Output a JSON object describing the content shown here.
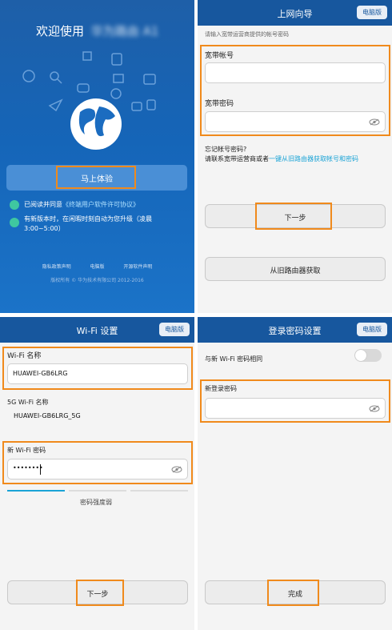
{
  "screen1": {
    "welcome": "欢迎使用",
    "blurred_brand": "华为路由 A1",
    "start_button": "马上体验",
    "agree_prefix": "已阅读并同意",
    "agree_link": "《终端用户软件许可协议》",
    "update_notice": "有新版本时，在闲暇时刻自动为您升级（凌晨3:00~5:00）",
    "footer_links": [
      "隐私政策声明",
      "电脑版",
      "开源软件声明"
    ],
    "copyright": "版权所有 © 华为技术有限公司 2012-2016"
  },
  "screen2": {
    "title": "上网向导",
    "pc_button": "电脑版",
    "hint": "请输入宽带运营商提供的帐号密码",
    "account_label": "宽带帐号",
    "password_label": "宽带密码",
    "forgot_q": "忘记帐号密码?",
    "forgot_text": "请联系宽带运营商或者",
    "forgot_link": "一键从旧路由器获取帐号和密码",
    "next_button": "下一步",
    "old_router_button": "从旧路由器获取"
  },
  "screen3": {
    "title": "Wi-Fi 设置",
    "pc_button": "电脑版",
    "wifi_name_label": "Wi-Fi 名称",
    "wifi_name_value": "HUAWEI-GB6LRG",
    "wifi5g_label": "5G Wi-Fi 名称",
    "wifi5g_value": "HUAWEI-GB6LRG_5G",
    "wifi_pwd_label": "新 Wi-Fi 密码",
    "wifi_pwd_value": "••••••••",
    "strength_text": "密码强度弱",
    "next_button": "下一步"
  },
  "screen4": {
    "title": "登录密码设置",
    "pc_button": "电脑版",
    "same_label": "与新 Wi-Fi 密码相同",
    "new_pwd_label": "新登录密码",
    "done_button": "完成"
  },
  "colors": {
    "orange": "#f08a1c",
    "blue": "#17579e",
    "link": "#1aa3d6",
    "check": "#3fc7a0"
  }
}
